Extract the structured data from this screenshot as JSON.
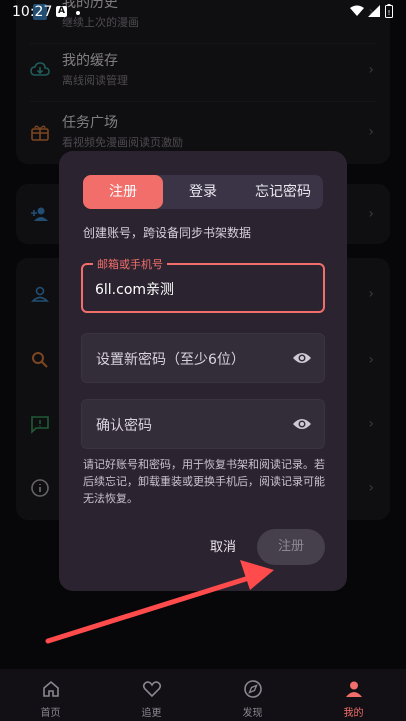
{
  "status": {
    "time": "10:27",
    "notif_icon": "A"
  },
  "menu": {
    "history": {
      "title": "我的历史",
      "sub": "继续上次的漫画"
    },
    "cache": {
      "title": "我的缓存",
      "sub": "离线阅读管理"
    },
    "tasks": {
      "title": "任务广场",
      "sub": "看视频免漫画阅读页激励"
    }
  },
  "dialog": {
    "tabs": [
      {
        "label": "注册"
      },
      {
        "label": "登录"
      },
      {
        "label": "忘记密码"
      }
    ],
    "active_tab": "注册",
    "description": "创建账号，跨设备同步书架数据",
    "account_label": "邮箱或手机号",
    "account_value": "6ll.com亲测",
    "password_placeholder": "设置新密码（至少6位）",
    "confirm_placeholder": "确认密码",
    "note": "请记好账号和密码，用于恢复书架和阅读记录。若后续忘记，卸载重装或更换手机后，阅读记录可能无法恢复。",
    "cancel_label": "取消",
    "register_label": "注册"
  },
  "nav": [
    {
      "label": "首页"
    },
    {
      "label": "追更"
    },
    {
      "label": "发现"
    },
    {
      "label": "我的"
    }
  ],
  "colors": {
    "accent": "#f26e6b",
    "dialog_bg": "#2b2430"
  }
}
